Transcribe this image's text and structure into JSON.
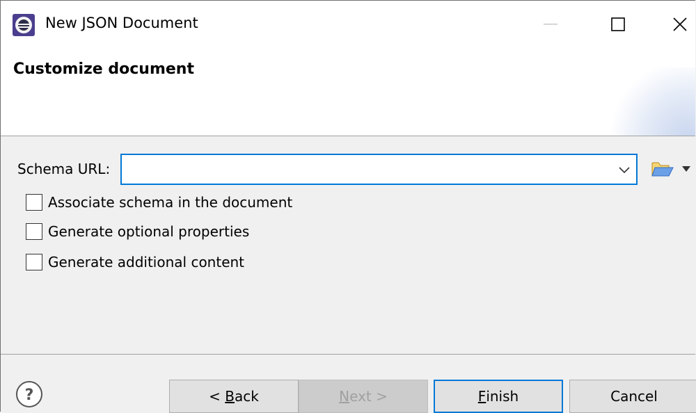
{
  "window": {
    "title": "New JSON Document",
    "icon": "eclipse-app-icon",
    "controls": [
      "minimize-icon",
      "maximize-icon",
      "close-icon"
    ]
  },
  "banner": {
    "heading": "Customize document"
  },
  "form": {
    "schema_label": "Schema URL:",
    "schema_value": "",
    "schema_placeholder": "",
    "browse_icon": "folder-open-icon",
    "options": [
      {
        "label": "Associate schema in the document",
        "checked": false
      },
      {
        "label": "Generate optional properties",
        "checked": false
      },
      {
        "label": "Generate additional content",
        "checked": false
      }
    ]
  },
  "footer": {
    "help_icon": "help-icon",
    "back": {
      "prefix": "< ",
      "mnemonic": "B",
      "rest": "ack",
      "enabled": true
    },
    "next": {
      "mnemonic": "N",
      "rest": "ext >",
      "enabled": false
    },
    "finish": {
      "mnemonic": "F",
      "rest": "inish",
      "enabled": true,
      "default": true
    },
    "cancel": {
      "label": "Cancel",
      "enabled": true
    }
  },
  "colors": {
    "accent": "#0078d7",
    "dialog_bg": "#f0f0f0",
    "disabled_text": "#a0a0a0"
  }
}
